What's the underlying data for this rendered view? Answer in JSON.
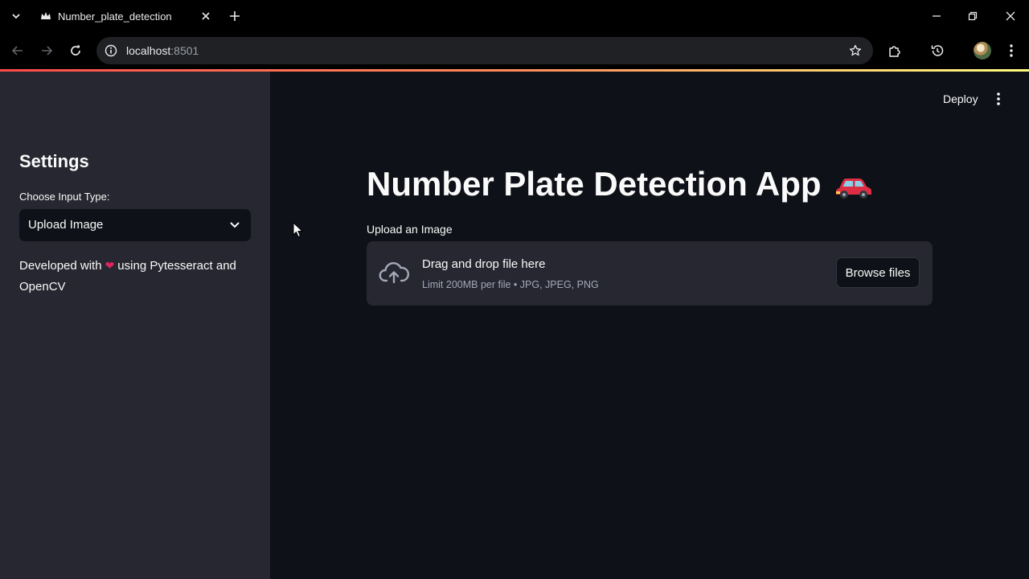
{
  "browser": {
    "tab_title": "Number_plate_detection",
    "url_host": "localhost",
    "url_port": ":8501"
  },
  "sidebar": {
    "heading": "Settings",
    "input_type_label": "Choose Input Type:",
    "input_type_value": "Upload Image",
    "note_prefix": "Developed with",
    "note_suffix": "using Pytesseract and OpenCV"
  },
  "main": {
    "deploy_label": "Deploy",
    "title": "Number Plate Detection App",
    "upload_label": "Upload an Image",
    "dropzone_title": "Drag and drop file here",
    "dropzone_limit": "Limit 200MB per file • JPG, JPEG, PNG",
    "browse_label": "Browse files"
  },
  "colors": {
    "app_background": "#0e1117",
    "sidebar_background": "#262730",
    "accent": "#ff4b4b"
  }
}
